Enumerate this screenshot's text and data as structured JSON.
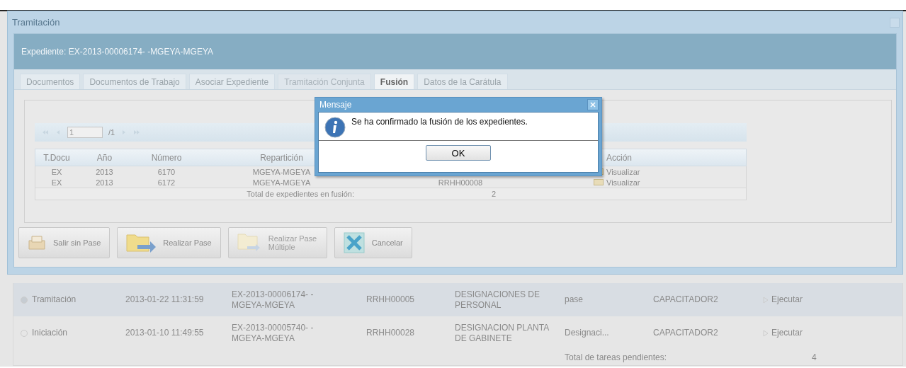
{
  "window": {
    "title": "Tramitación"
  },
  "header": "Expediente: EX-2013-00006174- -MGEYA-MGEYA",
  "tabs": [
    {
      "label": "Documentos",
      "selected": false,
      "disabled": false
    },
    {
      "label": "Documentos de Trabajo",
      "selected": false,
      "disabled": false
    },
    {
      "label": "Asociar Expediente",
      "selected": false,
      "disabled": false
    },
    {
      "label": "Tramitación Conjunta",
      "selected": false,
      "disabled": true
    },
    {
      "label": "Fusión",
      "selected": true,
      "disabled": false
    },
    {
      "label": "Datos de la Carátula",
      "selected": false,
      "disabled": false
    }
  ],
  "grid": {
    "pager": {
      "page": "1",
      "total": "/1"
    },
    "columns": [
      "T.Docu",
      "Año",
      "Número",
      "Repartición",
      "Acción"
    ],
    "rows": [
      {
        "t_docu": "EX",
        "anio": "2013",
        "numero": "6170",
        "reparticion": "MGEYA-MGEYA",
        "accion": "Visualizar"
      },
      {
        "t_docu": "EX",
        "anio": "2013",
        "numero": "6172",
        "reparticion": "MGEYA-MGEYA",
        "column_5": "RRHH00008",
        "accion": "Visualizar"
      }
    ],
    "footer_label": "Total de expedientes en fusión:",
    "footer_count": "2"
  },
  "buttons": [
    {
      "label": "Salir sin Pase",
      "kind": "inbox",
      "disabled": false
    },
    {
      "label": "Realizar Pase",
      "kind": "folder",
      "disabled": false
    },
    {
      "label": "Realizar Pase Múltiple",
      "kind": "multi",
      "disabled": true
    },
    {
      "label": "Cancelar",
      "kind": "cancel",
      "disabled": false
    }
  ],
  "dialog": {
    "title": "Mensaje",
    "message": "Se ha confirmado la fusión de los expedientes.",
    "button": "OK"
  },
  "tasks": {
    "rows": [
      {
        "selected": true,
        "estado": "Tramitación",
        "fecha": "2013-01-22 11:31:59",
        "expediente": "EX-2013-00006174- -MGEYA-MGEYA",
        "codigo": "RRHH00005",
        "descripcion": "DESIGNACIONES DE PERSONAL",
        "motivo": "pase",
        "usuario": "CAPACITADOR2",
        "accion": "Ejecutar"
      },
      {
        "selected": false,
        "estado": "Iniciación",
        "fecha": "2013-01-10 11:49:55",
        "expediente": "EX-2013-00005740- -MGEYA-MGEYA",
        "codigo": "RRHH00028",
        "descripcion": "DESIGNACION PLANTA DE GABINETE",
        "motivo": "Designaci...",
        "usuario": "CAPACITADOR2",
        "accion": "Ejecutar"
      }
    ],
    "footer_label": "Total de tareas pendientes:",
    "footer_count": "4"
  }
}
